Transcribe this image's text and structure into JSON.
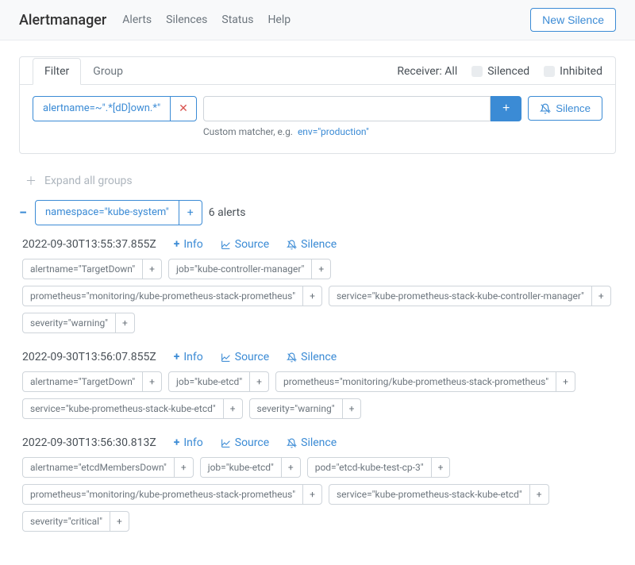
{
  "nav": {
    "brand": "Alertmanager",
    "links": [
      "Alerts",
      "Silences",
      "Status",
      "Help"
    ],
    "new_silence": "New Silence"
  },
  "panel": {
    "tabs": {
      "filter": "Filter",
      "group": "Group"
    },
    "receiver_label": "Receiver: All",
    "silenced_label": "Silenced",
    "inhibited_label": "Inhibited",
    "active_matcher": "alertname=~\".*[dD]own.*\"",
    "hint_prefix": "Custom matcher, e.g.",
    "hint_example": "env=\"production\"",
    "silence_btn": "Silence"
  },
  "expand_all": "Expand all groups",
  "group": {
    "label": "namespace=\"kube-system\"",
    "count": "6 alerts"
  },
  "actions": {
    "info": "Info",
    "source": "Source",
    "silence": "Silence"
  },
  "alerts": [
    {
      "ts": "2022-09-30T13:55:37.855Z",
      "labels": [
        "alertname=\"TargetDown\"",
        "job=\"kube-controller-manager\"",
        "prometheus=\"monitoring/kube-prometheus-stack-prometheus\"",
        "service=\"kube-prometheus-stack-kube-controller-manager\"",
        "severity=\"warning\""
      ]
    },
    {
      "ts": "2022-09-30T13:56:07.855Z",
      "labels": [
        "alertname=\"TargetDown\"",
        "job=\"kube-etcd\"",
        "prometheus=\"monitoring/kube-prometheus-stack-prometheus\"",
        "service=\"kube-prometheus-stack-kube-etcd\"",
        "severity=\"warning\""
      ]
    },
    {
      "ts": "2022-09-30T13:56:30.813Z",
      "labels": [
        "alertname=\"etcdMembersDown\"",
        "job=\"kube-etcd\"",
        "pod=\"etcd-kube-test-cp-3\"",
        "prometheus=\"monitoring/kube-prometheus-stack-prometheus\"",
        "service=\"kube-prometheus-stack-kube-etcd\"",
        "severity=\"critical\""
      ]
    }
  ]
}
